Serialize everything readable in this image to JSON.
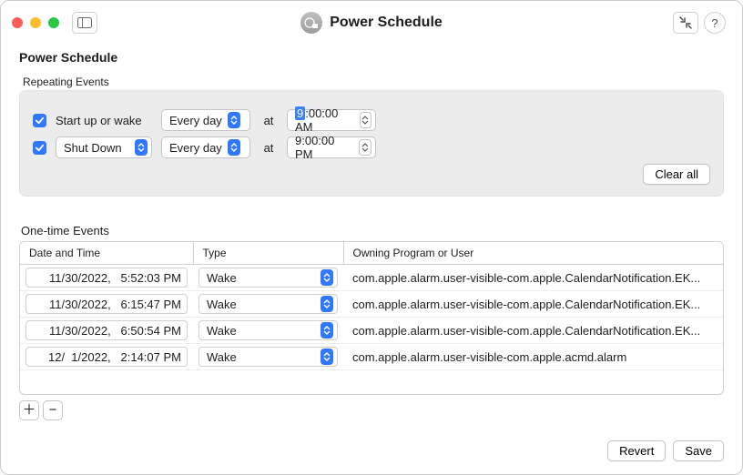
{
  "window_title": "Power Schedule",
  "section_title": "Power Schedule",
  "repeating": {
    "group_label": "Repeating Events",
    "at_label": "at",
    "row1": {
      "checked": true,
      "action_label": "Start up or wake",
      "freq": "Every day",
      "time_hour_sel": "9",
      "time_rest": ":00:00 AM"
    },
    "row2": {
      "checked": true,
      "action_select": "Shut Down",
      "freq": "Every day",
      "time": "9:00:00 PM"
    },
    "clear_all": "Clear all"
  },
  "onetime": {
    "label": "One-time Events",
    "columns": {
      "dt": "Date and Time",
      "type": "Type",
      "owner": "Owning Program or User"
    },
    "rows": [
      {
        "dt": "11/30/2022,   5:52:03 PM",
        "type": "Wake",
        "owner": "com.apple.alarm.user-visible-com.apple.CalendarNotification.EK..."
      },
      {
        "dt": "11/30/2022,   6:15:47 PM",
        "type": "Wake",
        "owner": "com.apple.alarm.user-visible-com.apple.CalendarNotification.EK..."
      },
      {
        "dt": "11/30/2022,   6:50:54 PM",
        "type": "Wake",
        "owner": "com.apple.alarm.user-visible-com.apple.CalendarNotification.EK..."
      },
      {
        "dt": "12/  1/2022,   2:14:07 PM",
        "type": "Wake",
        "owner": "com.apple.alarm.user-visible-com.apple.acmd.alarm"
      }
    ]
  },
  "footer": {
    "revert": "Revert",
    "save": "Save"
  }
}
